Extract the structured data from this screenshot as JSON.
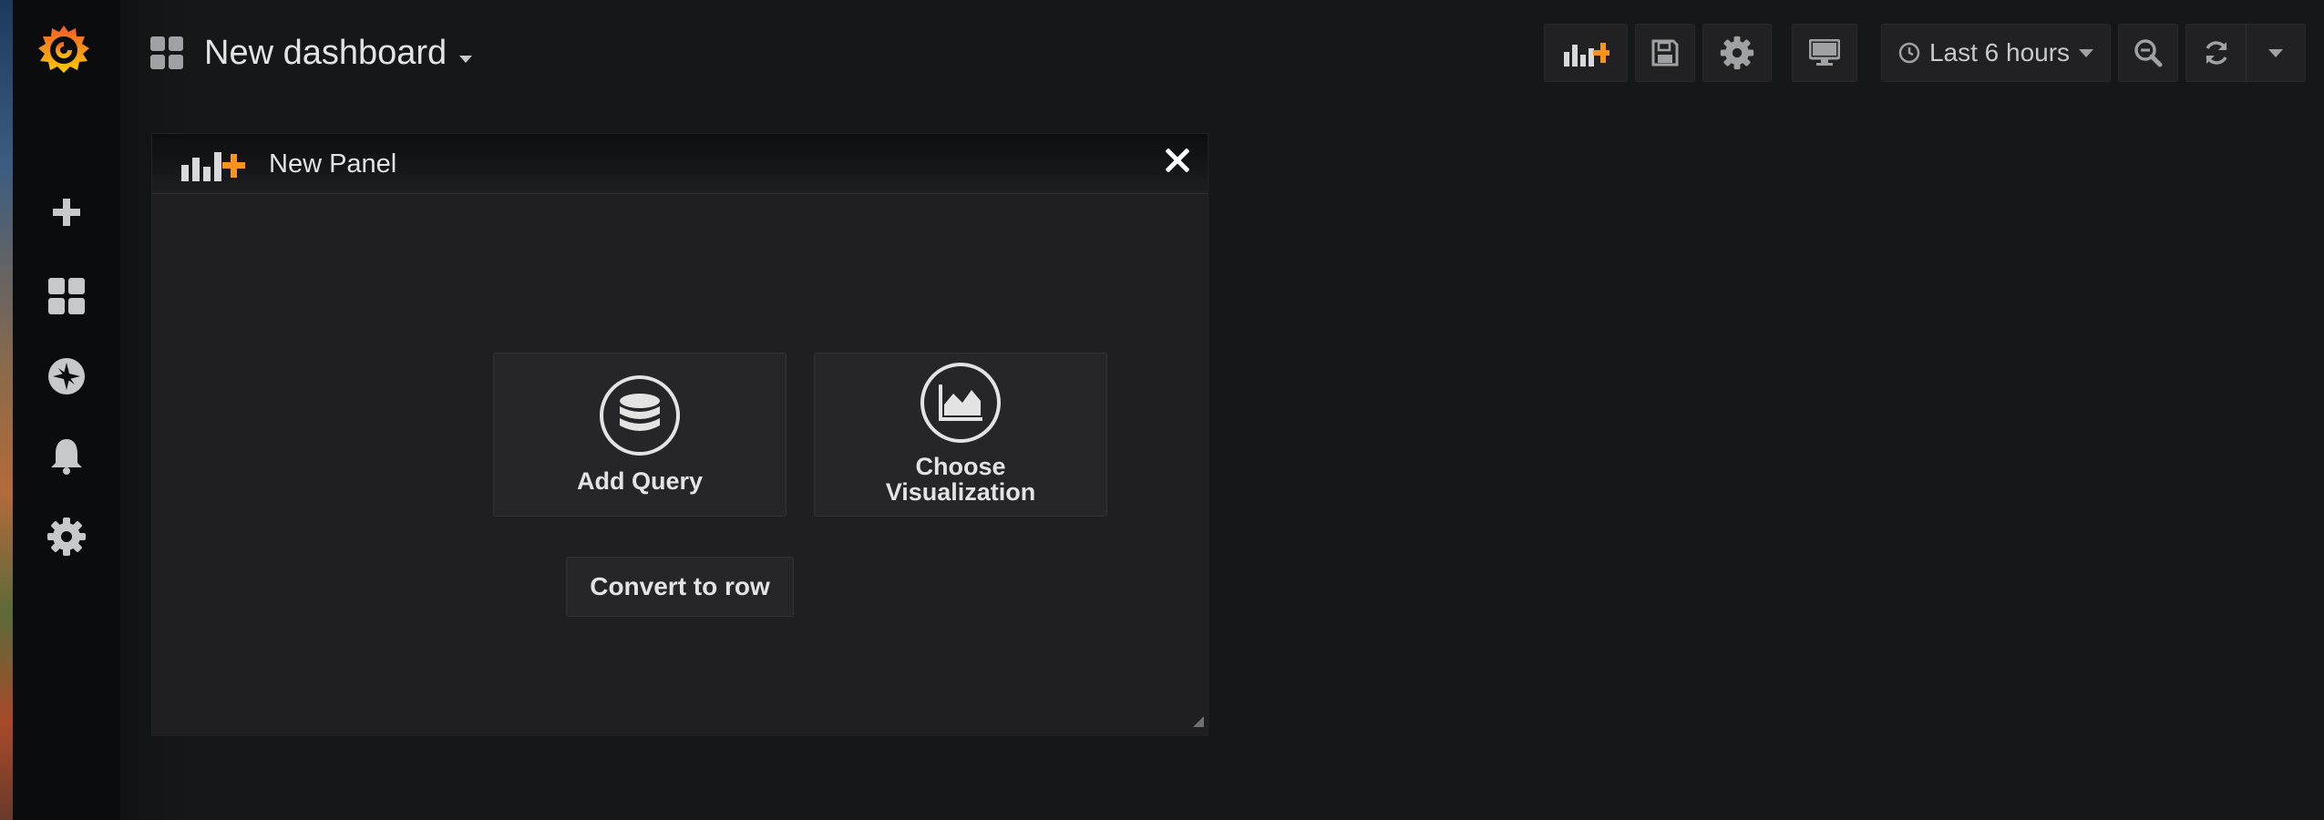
{
  "navbar": {
    "title": "New dashboard",
    "time_range": "Last 6 hours"
  },
  "sidemenu": {
    "items": [
      "create-icon",
      "dashboards-icon",
      "explore-icon",
      "alerting-icon",
      "configuration-icon"
    ]
  },
  "panel": {
    "title": "New Panel",
    "actions": {
      "add_query": "Add Query",
      "choose_visualization_line1": "Choose",
      "choose_visualization_line2": "Visualization"
    },
    "convert_to_row": "Convert to row"
  },
  "colors": {
    "accent_orange": "#f7941d",
    "background": "#161719",
    "sidemenu": "#0b0c0e",
    "panel": "#1f1f22"
  }
}
